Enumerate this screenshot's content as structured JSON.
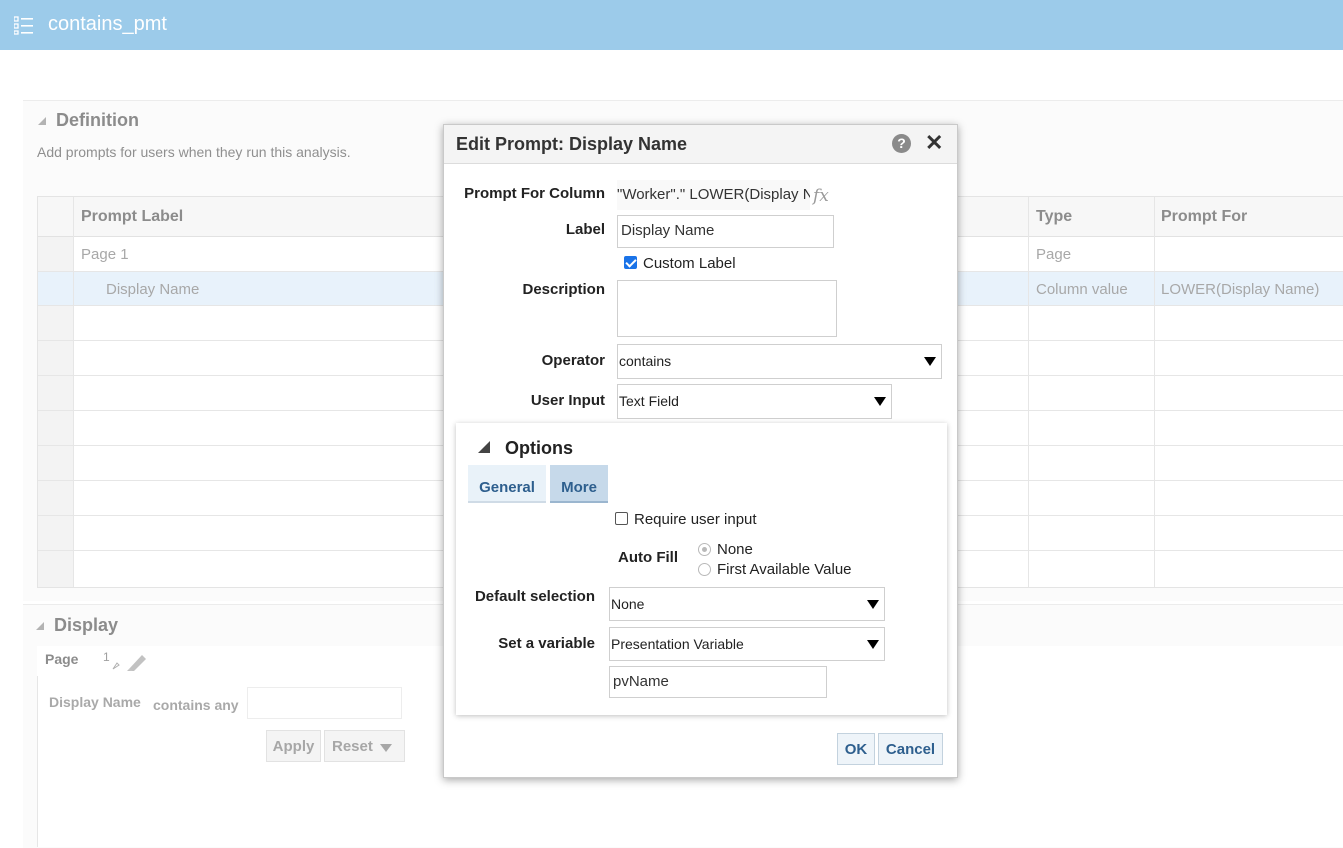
{
  "app": {
    "title": "contains_pmt"
  },
  "definition": {
    "header": "Definition",
    "hint": "Add prompts for users when they run this analysis.",
    "columns": [
      "Prompt Label",
      "Type",
      "Prompt For"
    ],
    "rows": [
      {
        "label": "Page 1",
        "type": "Page",
        "prompt_for": ""
      },
      {
        "label": "Display Name",
        "type": "Column value",
        "prompt_for": "LOWER(Display Name)"
      }
    ]
  },
  "display": {
    "header": "Display",
    "page_label": "Page",
    "page_number": "1",
    "preview_label": "Display Name",
    "preview_operator": "contains any",
    "apply_label": "Apply",
    "reset_label": "Reset"
  },
  "dialog": {
    "title": "Edit Prompt: Display Name",
    "prompt_for_column_label": "Prompt For Column",
    "prompt_for_column_value": "\"Worker\".\" LOWER(Display N",
    "fx_symbol": "fx",
    "label_label": "Label",
    "label_value": "Display Name",
    "custom_label": "Custom Label",
    "custom_label_checked": true,
    "description_label": "Description",
    "description_value": "",
    "operator_label": "Operator",
    "operator_value": "contains",
    "user_input_label": "User Input",
    "user_input_value": "Text Field",
    "options": {
      "title": "Options",
      "tabs": [
        "General",
        "More"
      ],
      "active_tab": "More",
      "require_user_input": "Require user input",
      "require_user_input_checked": false,
      "auto_fill_label": "Auto Fill",
      "auto_fill_options": [
        "None",
        "First Available Value"
      ],
      "auto_fill_selected": "None",
      "default_selection_label": "Default selection",
      "default_selection_value": "None",
      "set_variable_label": "Set a variable",
      "set_variable_value": "Presentation Variable",
      "variable_name": "pvName"
    },
    "ok_label": "OK",
    "cancel_label": "Cancel"
  }
}
